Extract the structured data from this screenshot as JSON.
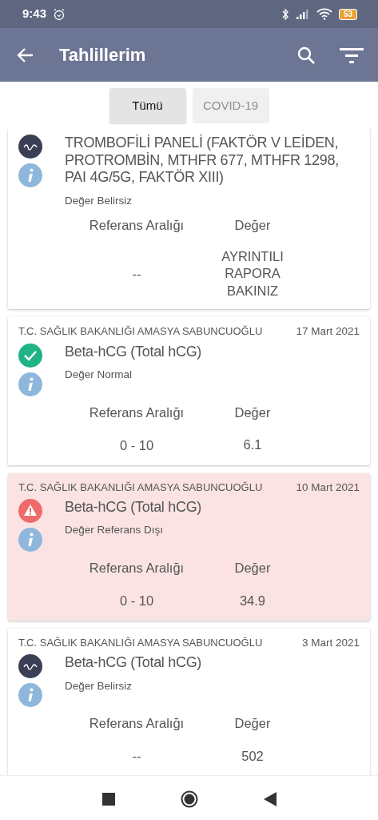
{
  "status_bar": {
    "time": "9:43",
    "battery": "53"
  },
  "app_bar": {
    "title": "Tahlillerim"
  },
  "filters": [
    {
      "label": "Tümü",
      "selected": true
    },
    {
      "label": "COVID-19",
      "selected": false
    }
  ],
  "results": [
    {
      "kind": "uncertain",
      "test": "TROMBOFİLİ PANELİ (FAKTÖR V LEİDEN, PROTROMBİN, MTHFR 677, MTHFR 1298, PAI 4G/5G, FAKTÖR XIII)",
      "status": "Değer Belirsiz",
      "range_label": "Referans Aralığı",
      "value_label": "Değer",
      "range": "--",
      "value": "AYRINTILI RAPORA BAKINIZ"
    },
    {
      "kind": "normal",
      "hospital": "T.C. SAĞLIK BAKANLIĞI AMASYA SABUNCUOĞLU",
      "date": "17 Mart 2021",
      "test": "Beta-hCG (Total hCG)",
      "status": "Değer Normal",
      "range_label": "Referans Aralığı",
      "value_label": "Değer",
      "range": "0 - 10",
      "value": "6.1"
    },
    {
      "kind": "abnormal",
      "hospital": "T.C. SAĞLIK BAKANLIĞI AMASYA SABUNCUOĞLU",
      "date": "10 Mart 2021",
      "test": "Beta-hCG (Total hCG)",
      "status": "Değer Referans Dışı",
      "range_label": "Referans Aralığı",
      "value_label": "Değer",
      "range": "0 - 10",
      "value": "34.9"
    },
    {
      "kind": "uncertain",
      "hospital": "T.C. SAĞLIK BAKANLIĞI AMASYA SABUNCUOĞLU",
      "date": "3 Mart 2021",
      "test": "Beta-hCG (Total hCG)",
      "status": "Değer Belirsiz",
      "range_label": "Referans Aralığı",
      "value_label": "Değer",
      "range": "--",
      "value": "502"
    }
  ]
}
